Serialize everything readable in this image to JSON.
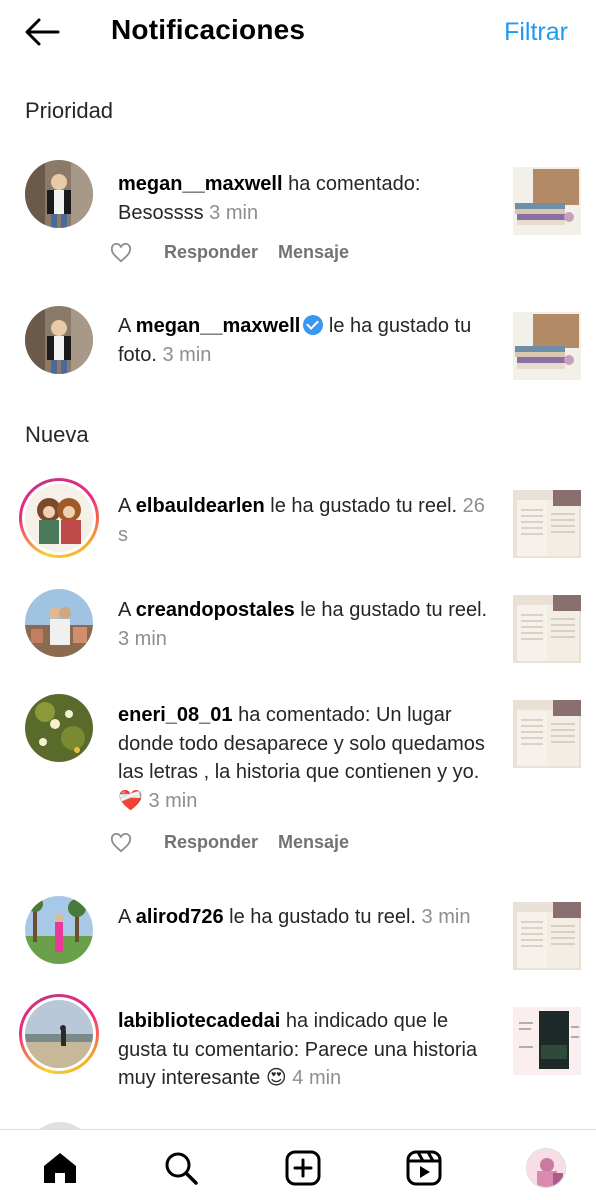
{
  "header": {
    "title": "Notificaciones",
    "filter_label": "Filtrar",
    "back_icon": "arrow-left-icon"
  },
  "sections": {
    "priority": "Prioridad",
    "new": "Nueva"
  },
  "actions": {
    "reply": "Responder",
    "message": "Mensaje"
  },
  "notifications": [
    {
      "prefix": "",
      "user": "megan__maxwell",
      "text": " ha comentado: Besossss ",
      "time": "3 min",
      "has_actions": true,
      "verified": false
    },
    {
      "prefix": "A ",
      "user": "megan__maxwell",
      "text": " le ha gustado tu foto. ",
      "time": "3 min",
      "has_actions": false,
      "verified": true
    },
    {
      "prefix": "A ",
      "user": "elbauldearlen",
      "text": " le ha gustado tu reel. ",
      "time": "26 s",
      "has_actions": false,
      "verified": false
    },
    {
      "prefix": "A ",
      "user": "creandopostales",
      "text": " le ha gustado tu reel. ",
      "time": "3 min",
      "has_actions": false,
      "verified": false
    },
    {
      "prefix": "",
      "user": "eneri_08_01",
      "text": " ha comentado: Un lugar donde todo desaparece y solo quedamos las letras , la historia que contienen y yo.❤️‍🩹 ",
      "time": "3 min",
      "has_actions": true,
      "verified": false
    },
    {
      "prefix": "A ",
      "user": "alirod726",
      "text": " le ha gustado tu reel. ",
      "time": "3 min",
      "has_actions": false,
      "verified": false
    },
    {
      "prefix": "",
      "user": "labibliotecadedai",
      "text": " ha indicado que le gusta tu comentario: Parece una historia muy interesante 😍 ",
      "time": "4 min",
      "has_actions": false,
      "verified": false
    }
  ],
  "bottom_nav": [
    {
      "name": "home-icon"
    },
    {
      "name": "search-icon"
    },
    {
      "name": "new-post-icon"
    },
    {
      "name": "reels-icon"
    },
    {
      "name": "profile-avatar"
    }
  ],
  "colors": {
    "accent": "#1d9bf0",
    "text": "#262626",
    "muted": "#8e8e8e",
    "verified": "#3897f0"
  }
}
